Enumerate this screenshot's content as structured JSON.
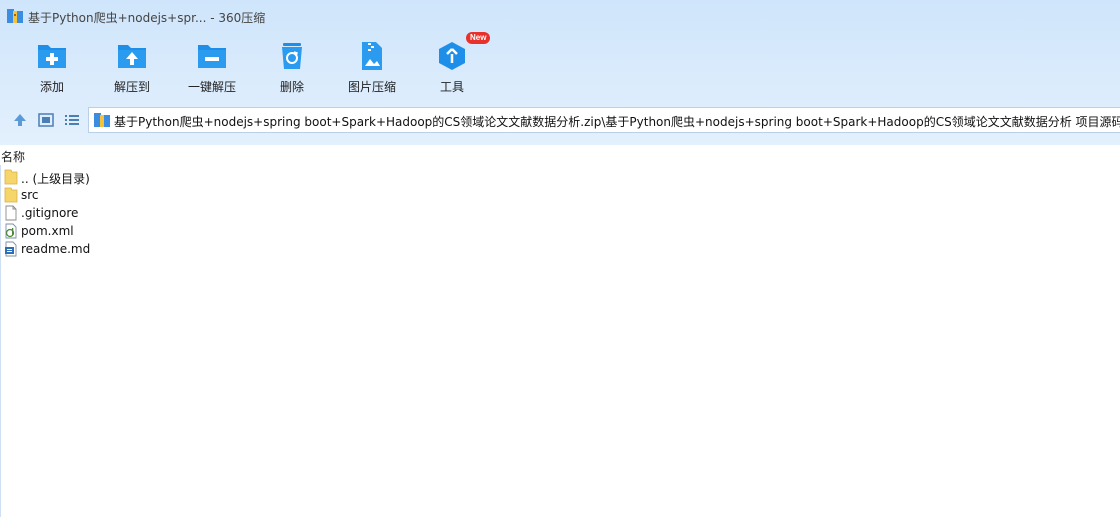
{
  "window": {
    "title": "基于Python爬虫+nodejs+spr... - 360压缩"
  },
  "toolbar": {
    "add": "添加",
    "extract_to": "解压到",
    "one_click_extract": "一键解压",
    "delete": "删除",
    "image_compress": "图片压缩",
    "tools": "工具",
    "tools_badge": "New"
  },
  "address_bar": {
    "path": "基于Python爬虫+nodejs+spring boot+Spark+Hadoop的CS领域论文文献数据分析.zip\\基于Python爬虫+nodejs+spring boot+Spark+Hadoop的CS领域论文文献数据分析 项目源码及"
  },
  "list": {
    "column_name": "名称",
    "items": [
      {
        "name": ".. (上级目录)",
        "icon": "folder-icon"
      },
      {
        "name": "src",
        "icon": "folder-icon"
      },
      {
        "name": ".gitignore",
        "icon": "file-icon"
      },
      {
        "name": "pom.xml",
        "icon": "xml-file-icon"
      },
      {
        "name": "readme.md",
        "icon": "md-file-icon"
      }
    ]
  },
  "colors": {
    "accent": "#1e8fe8",
    "header_bg": "#d8eafc",
    "badge": "#e8312a"
  }
}
